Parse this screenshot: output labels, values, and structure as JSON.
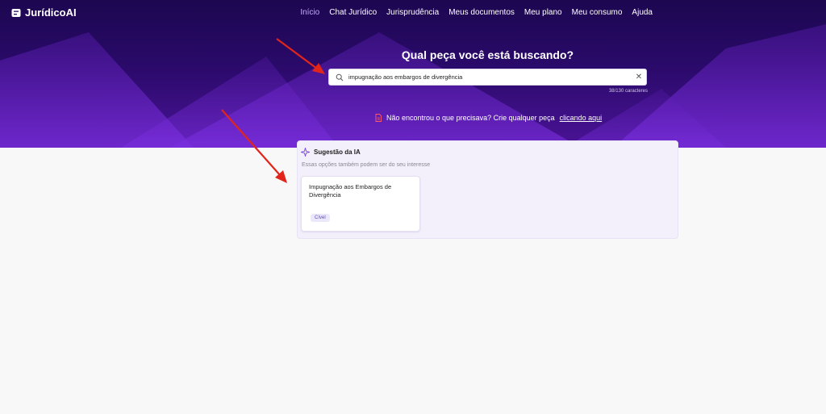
{
  "app": {
    "logo_text": "JurídicoAI"
  },
  "nav": {
    "items": [
      {
        "label": "Início"
      },
      {
        "label": "Chat Jurídico"
      },
      {
        "label": "Jurisprudência"
      },
      {
        "label": "Meus documentos"
      },
      {
        "label": "Meu plano"
      },
      {
        "label": "Meu consumo"
      },
      {
        "label": "Ajuda"
      }
    ],
    "active_index": 0
  },
  "hero": {
    "title": "Qual peça você está buscando?",
    "search_value": "impugnação aos embargos de divergência",
    "char_counter": "38/130 caracteres",
    "not_found_text": "Não encontrou o que precisava? Crie qualquer peça",
    "not_found_link": "clicando aqui"
  },
  "suggestions": {
    "heading": "Sugestão da IA",
    "subheading": "Essas opções também podem ser do seu interesse",
    "cards": [
      {
        "title": "Impugnação aos Embargos de Divergência",
        "tag": "Cível"
      }
    ]
  },
  "colors": {
    "hero_dark": "#1c0750",
    "hero_purple": "#7b2fe0",
    "nav_active": "#c6a9ff",
    "annotation_arrow": "#e1251b",
    "tag_text": "#5b48c8"
  },
  "icons": [
    "logo-icon",
    "search-icon",
    "clear-icon",
    "document-icon",
    "sparkle-icon"
  ]
}
